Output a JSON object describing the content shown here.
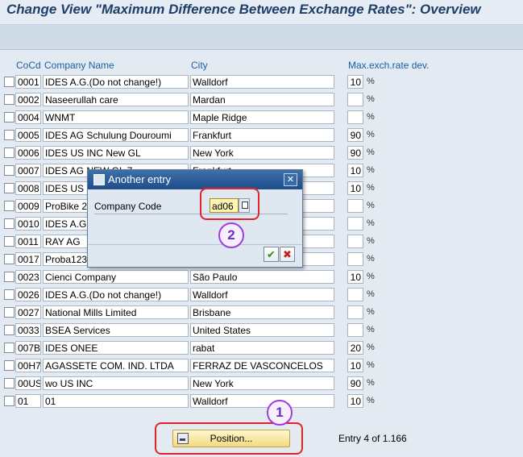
{
  "title": "Change View \"Maximum Difference Between Exchange Rates\": Overview",
  "columns": {
    "cocd": "CoCd",
    "name": "Company Name",
    "city": "City",
    "dev": "Max.exch.rate dev."
  },
  "rows": [
    {
      "cocd": "0001",
      "name": "IDES A.G.(Do not change!)",
      "city": "Walldorf",
      "dev": "10",
      "pct": "%"
    },
    {
      "cocd": "0002",
      "name": "Naseerullah care",
      "city": "Mardan",
      "dev": "",
      "pct": "%"
    },
    {
      "cocd": "0004",
      "name": "WNMT",
      "city": "Maple Ridge",
      "dev": "",
      "pct": "%"
    },
    {
      "cocd": "0005",
      "name": "IDES AG Schulung Douroumi",
      "city": "Frankfurt",
      "dev": "90",
      "pct": "%"
    },
    {
      "cocd": "0006",
      "name": "IDES US INC New GL",
      "city": "New York",
      "dev": "90",
      "pct": "%"
    },
    {
      "cocd": "0007",
      "name": "IDES AG NEW GL 7",
      "city": "Frankfurt",
      "dev": "10",
      "pct": "%"
    },
    {
      "cocd": "0008",
      "name": "IDES US INC",
      "city": "",
      "dev": "10",
      "pct": "%"
    },
    {
      "cocd": "0009",
      "name": "ProBike 2.",
      "city": "",
      "dev": "",
      "pct": "%"
    },
    {
      "cocd": "0010",
      "name": "IDES A.G.",
      "city": "",
      "dev": "",
      "pct": "%"
    },
    {
      "cocd": "0011",
      "name": "RAY AG",
      "city": "",
      "dev": "",
      "pct": "%"
    },
    {
      "cocd": "0017",
      "name": "Proba123",
      "city": "",
      "dev": "",
      "pct": "%"
    },
    {
      "cocd": "0023",
      "name": "Cienci Company",
      "city": "São Paulo",
      "dev": "10",
      "pct": "%"
    },
    {
      "cocd": "0026",
      "name": "IDES A.G.(Do not change!)",
      "city": "Walldorf",
      "dev": "",
      "pct": "%"
    },
    {
      "cocd": "0027",
      "name": "National Mills Limited",
      "city": "Brisbane",
      "dev": "",
      "pct": "%"
    },
    {
      "cocd": "0033",
      "name": "BSEA  Services",
      "city": "United States",
      "dev": "",
      "pct": "%"
    },
    {
      "cocd": "007B",
      "name": "IDES ONEE",
      "city": "rabat",
      "dev": "20",
      "pct": "%"
    },
    {
      "cocd": "00H7",
      "name": "AGASSETE COM. IND. LTDA",
      "city": "FERRAZ DE VASCONCELOS",
      "dev": "10",
      "pct": "%"
    },
    {
      "cocd": "00US",
      "name": "wo US INC",
      "city": "New York",
      "dev": "90",
      "pct": "%"
    },
    {
      "cocd": "01",
      "name": "01",
      "city": "Walldorf",
      "dev": "10",
      "pct": "%"
    }
  ],
  "position_button": "Position...",
  "entry_info": "Entry 4 of 1.166",
  "dialog": {
    "title": "Another entry",
    "label": "Company Code",
    "value": "ad06",
    "close": "✕",
    "ok": "✔",
    "cancel": "✖"
  },
  "annotations": {
    "badge1": "1",
    "badge2": "2"
  },
  "colors": {
    "highlight": "#e0222a",
    "badge": "#a13be0",
    "header_text": "#1b5ea8"
  }
}
